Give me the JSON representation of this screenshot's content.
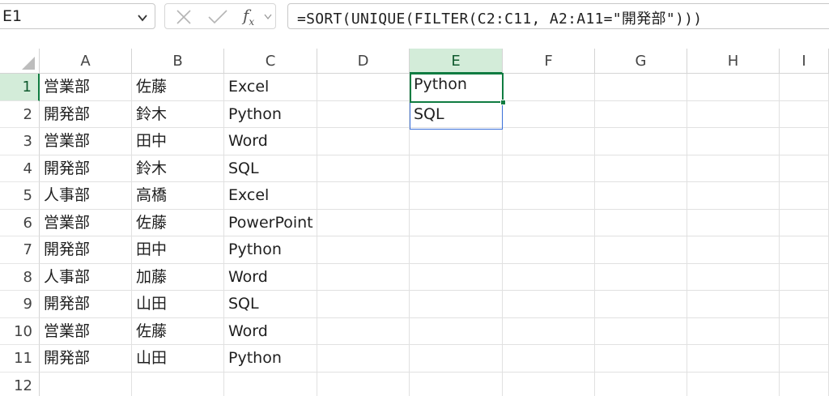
{
  "name_box": "E1",
  "formula": "=SORT(UNIQUE(FILTER(C2:C11, A2:A11=\"開発部\")))",
  "formula_icons": {
    "cancel": "x-icon",
    "enter": "check-icon",
    "function": "fx-icon"
  },
  "columns": [
    "A",
    "B",
    "C",
    "D",
    "E",
    "F",
    "G",
    "H",
    "I"
  ],
  "active_column": "E",
  "rows": [
    "1",
    "2",
    "3",
    "4",
    "5",
    "6",
    "7",
    "8",
    "9",
    "10",
    "11",
    "12"
  ],
  "data": [
    [
      "営業部",
      "佐藤",
      "Excel"
    ],
    [
      "開発部",
      "鈴木",
      "Python"
    ],
    [
      "営業部",
      "田中",
      "Word"
    ],
    [
      "開発部",
      "鈴木",
      "SQL"
    ],
    [
      "人事部",
      "高橋",
      "Excel"
    ],
    [
      "営業部",
      "佐藤",
      "PowerPoint"
    ],
    [
      "開発部",
      "田中",
      "Python"
    ],
    [
      "人事部",
      "加藤",
      "Word"
    ],
    [
      "開発部",
      "山田",
      "SQL"
    ],
    [
      "営業部",
      "佐藤",
      "Word"
    ],
    [
      "開発部",
      "山田",
      "Python"
    ]
  ],
  "spill_results": [
    "Python",
    "SQL"
  ],
  "accent_color": "#107c41",
  "spill_border_color": "#3a6fd8"
}
